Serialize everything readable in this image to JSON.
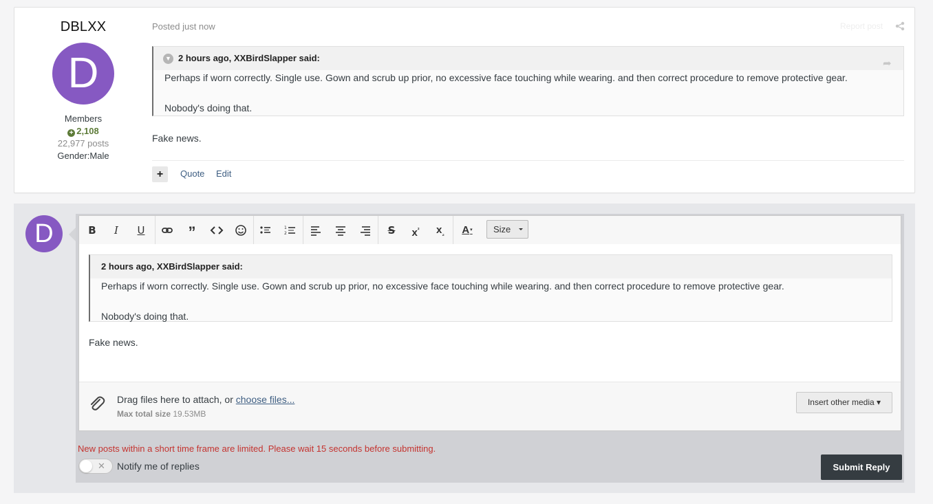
{
  "post": {
    "author": {
      "name": "DBLXX",
      "avatar_letter": "D",
      "avatar_color": "#8659c2",
      "group": "Members",
      "reputation": "2,108",
      "posts": "22,977 posts",
      "gender": "Gender:Male"
    },
    "meta": "Posted just now",
    "report": "Report post",
    "quote": {
      "header": "2 hours ago, XXBirdSlapper said:",
      "line1": "Perhaps if worn correctly. Single use. Gown and scrub up prior, no excessive face touching while wearing. and then correct procedure to remove protective gear.",
      "line2": "Nobody's doing that."
    },
    "body": "Fake news.",
    "actions": {
      "quote_label": "Quote",
      "edit_label": "Edit"
    }
  },
  "reply": {
    "avatar_letter": "D",
    "toolbar": {
      "bold": "B",
      "italic": "I",
      "underline": "U",
      "size_label": "Size"
    },
    "quote": {
      "header": "2 hours ago, XXBirdSlapper said:",
      "line1": "Perhaps if worn correctly. Single use. Gown and scrub up prior, no excessive face touching while wearing. and then correct procedure to remove protective gear.",
      "line2": "Nobody's doing that."
    },
    "body": "Fake news.",
    "attach": {
      "text": "Drag files here to attach, or ",
      "link": "choose files...",
      "size_label": "Max total size",
      "size_value": "19.53MB",
      "media_button": "Insert other media ▾"
    },
    "limit_message": "New posts within a short time frame are limited. Please wait 15 seconds before submitting.",
    "notify_label": "Notify me of replies",
    "submit_label": "Submit Reply"
  },
  "colors": {
    "accent_purple": "#8659c2",
    "link_blue": "#3e5e82",
    "warning_red": "#c4332f",
    "reputation_green": "#5d7b38",
    "submit_dark": "#353c41"
  }
}
